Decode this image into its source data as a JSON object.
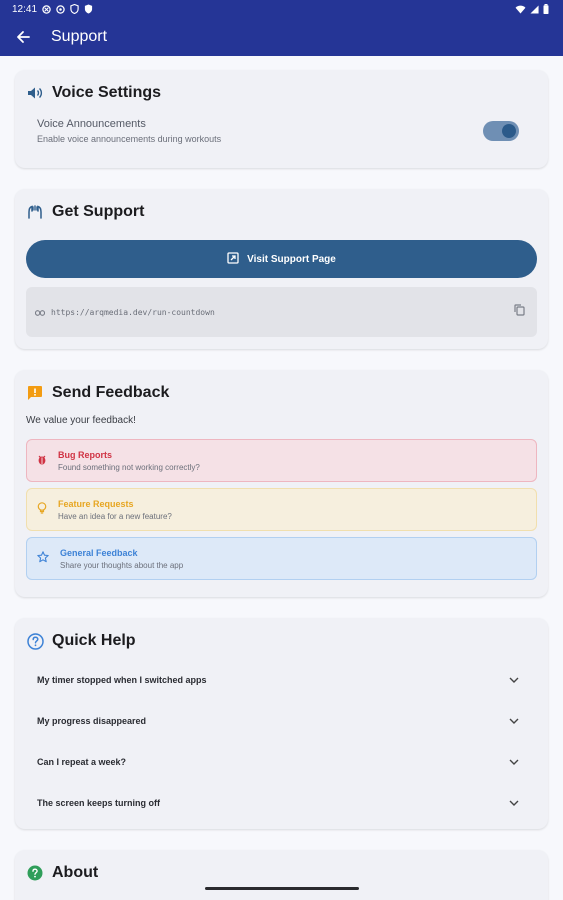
{
  "status_bar": {
    "time": "12:41"
  },
  "app_bar": {
    "title": "Support"
  },
  "voice_settings": {
    "title": "Voice Settings",
    "toggle_label": "Voice Announcements",
    "toggle_sub": "Enable voice announcements during workouts",
    "toggle_on": true
  },
  "get_support": {
    "title": "Get Support",
    "button_label": "Visit Support Page",
    "url": "https://arqmedia.dev/run-countdown"
  },
  "feedback": {
    "title": "Send Feedback",
    "intro": "We value your feedback!",
    "items": [
      {
        "title": "Bug Reports",
        "sub": "Found something not working correctly?",
        "color": "#d03344"
      },
      {
        "title": "Feature Requests",
        "sub": "Have an idea for a new feature?",
        "color": "#e7a622"
      },
      {
        "title": "General Feedback",
        "sub": "Share your thoughts about the app",
        "color": "#3d82d6"
      }
    ]
  },
  "quick_help": {
    "title": "Quick Help",
    "items": [
      "My timer stopped when I switched apps",
      "My progress disappeared",
      "Can I repeat a week?",
      "The screen keeps turning off"
    ]
  },
  "about": {
    "title": "About"
  },
  "colors": {
    "primary": "#253596",
    "accent": "#2f5e8c"
  }
}
